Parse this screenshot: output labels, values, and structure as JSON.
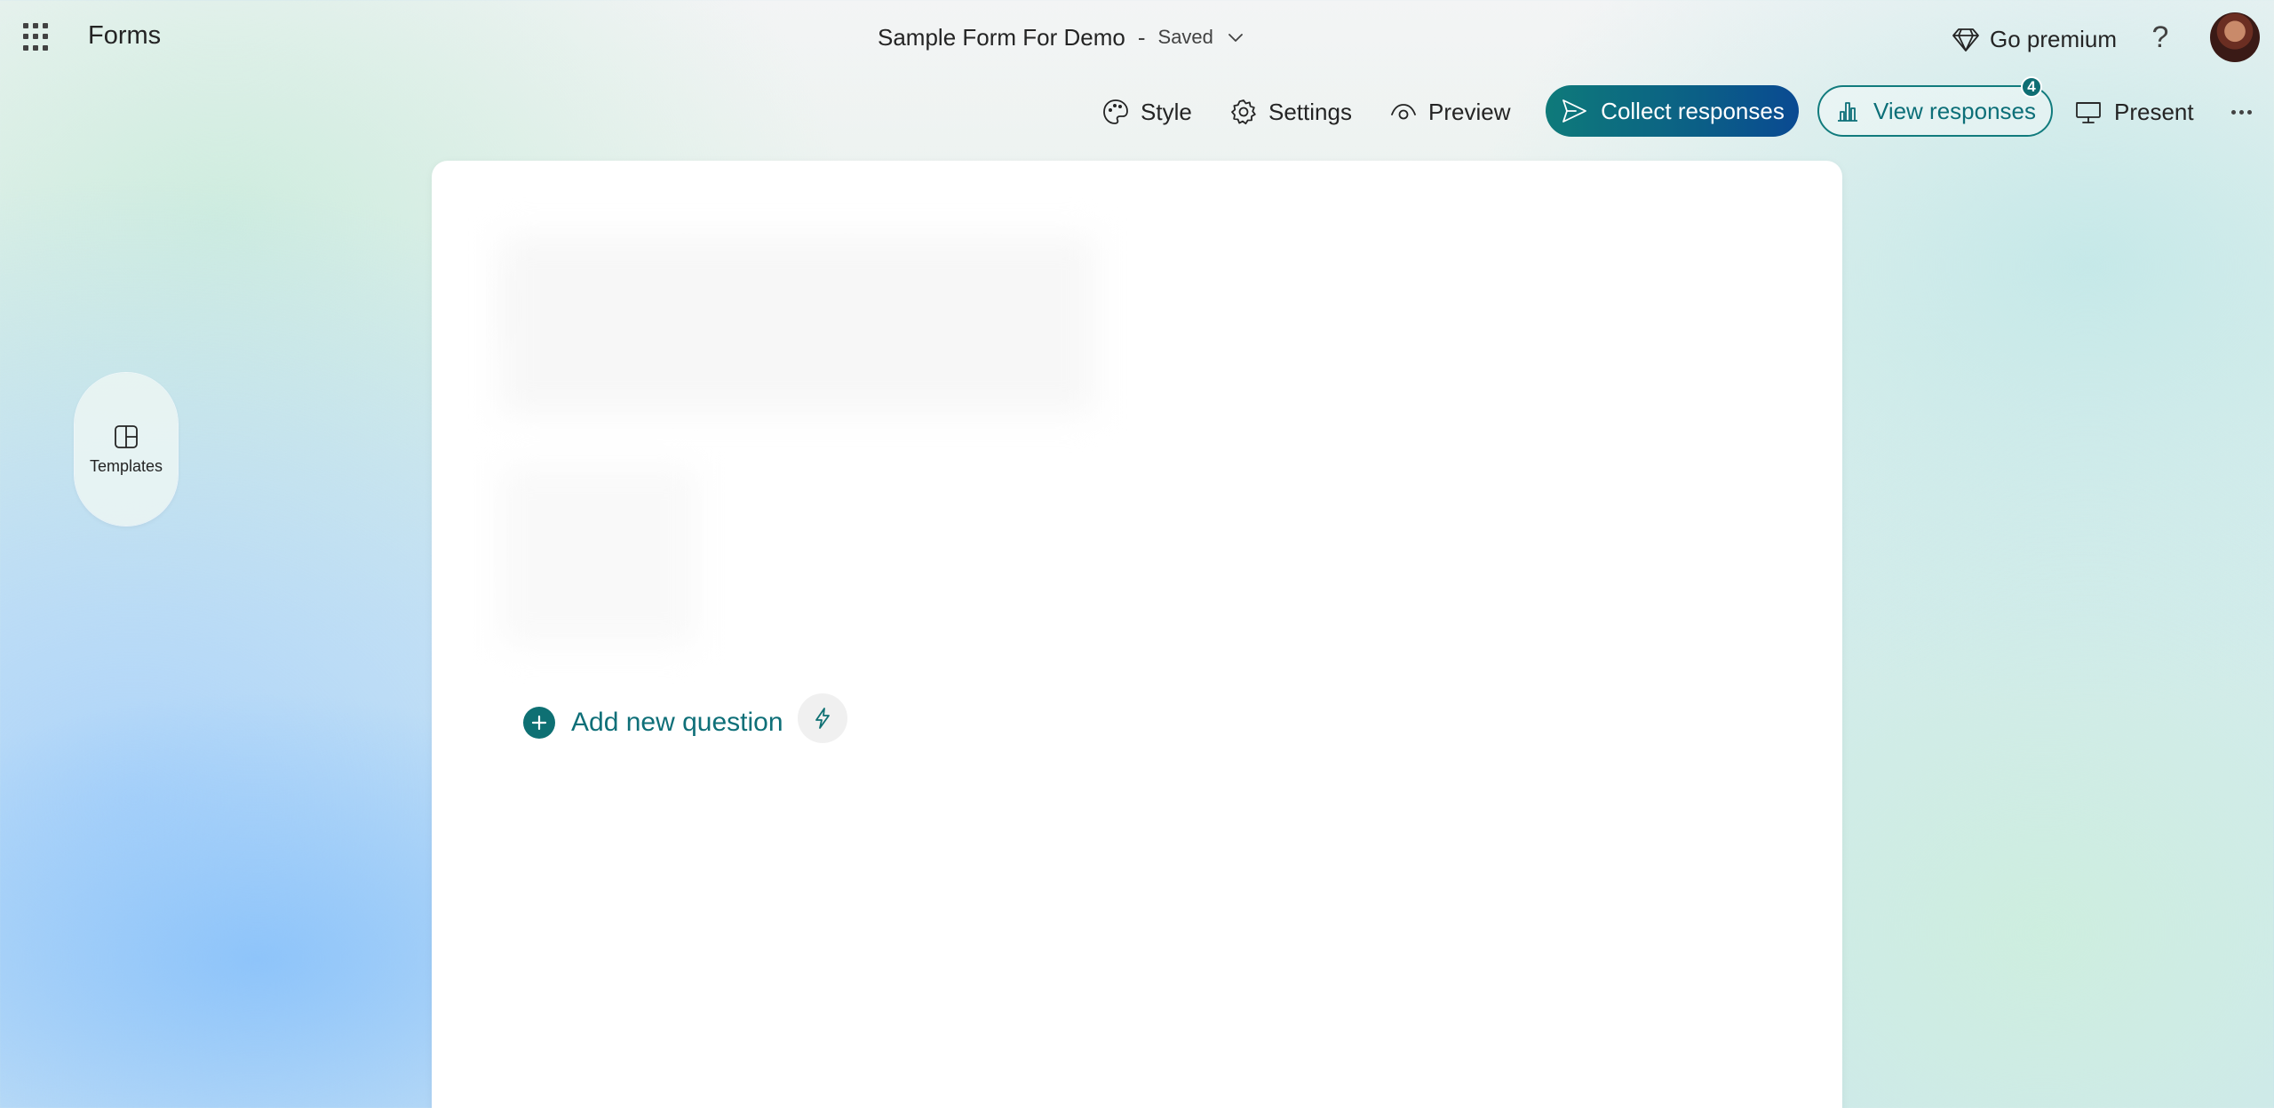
{
  "app": {
    "name": "Forms"
  },
  "form": {
    "title": "Sample Form For Demo",
    "separator": "-",
    "status": "Saved"
  },
  "header": {
    "premium_label": "Go premium",
    "help_label": "?"
  },
  "commands": {
    "style": "Style",
    "settings": "Settings",
    "preview": "Preview",
    "collect": "Collect responses",
    "view_responses": "View responses",
    "view_responses_count": "4",
    "present": "Present"
  },
  "left_rail": {
    "templates_label": "Templates"
  },
  "editor": {
    "add_question_label": "Add new question"
  },
  "colors": {
    "accent": "#0e7073",
    "collect_gradient_start": "#0e7a7a",
    "collect_gradient_end": "#0a4a92",
    "view_responses_text": "#0c6f78"
  },
  "icons": [
    "waffle-icon",
    "chevron-down-icon",
    "diamond-icon",
    "palette-icon",
    "gear-icon",
    "eye-icon",
    "send-icon",
    "bar-chart-icon",
    "presentation-icon",
    "more-icon",
    "templates-icon",
    "plus-icon",
    "lightning-icon"
  ]
}
